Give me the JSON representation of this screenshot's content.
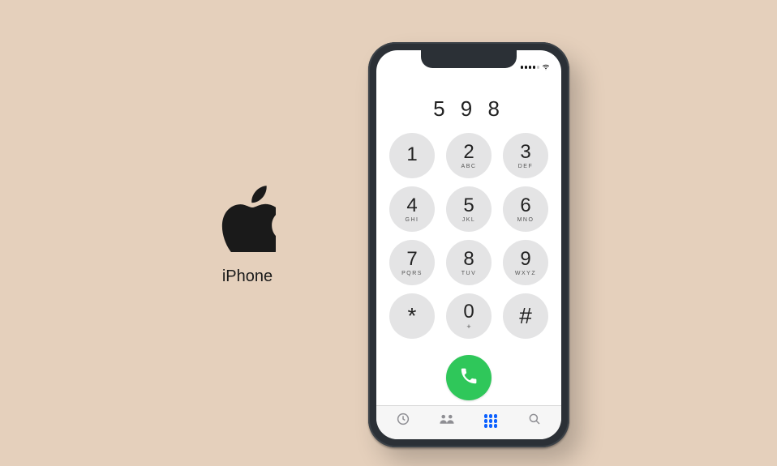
{
  "brand": {
    "label": "iPhone",
    "logo_name": "apple-logo"
  },
  "status": {
    "time": "",
    "signal_bars": 5,
    "signal_filled": 4,
    "network_icon": "wifi-icon"
  },
  "dialer": {
    "entered_number": "5 9 8",
    "keys": [
      {
        "digit": "1",
        "letters": ""
      },
      {
        "digit": "2",
        "letters": "ABC"
      },
      {
        "digit": "3",
        "letters": "DEF"
      },
      {
        "digit": "4",
        "letters": "GHI"
      },
      {
        "digit": "5",
        "letters": "JKL"
      },
      {
        "digit": "6",
        "letters": "MNO"
      },
      {
        "digit": "7",
        "letters": "PQRS"
      },
      {
        "digit": "8",
        "letters": "TUV"
      },
      {
        "digit": "9",
        "letters": "WXYZ"
      },
      {
        "digit": "*",
        "letters": ""
      },
      {
        "digit": "0",
        "letters": "+"
      },
      {
        "digit": "#",
        "letters": ""
      }
    ],
    "call_button": "Call",
    "call_color": "#2fc75a"
  },
  "tabs": {
    "recents_icon": "clock-icon",
    "contacts_icon": "people-icon",
    "keypad_icon": "keypad-icon",
    "search_icon": "search-icon",
    "active": "keypad"
  },
  "colors": {
    "background": "#e5d0bc",
    "key_bg": "#e4e4e5",
    "accent_blue": "#0b60ff",
    "call_green": "#2fc75a",
    "phone_body": "#2b3036"
  }
}
